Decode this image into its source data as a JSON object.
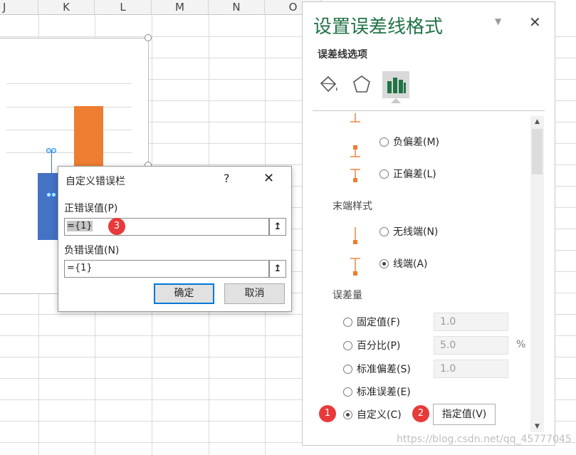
{
  "sheet": {
    "columns": [
      "J",
      "K",
      "L",
      "M",
      "N",
      "O"
    ]
  },
  "colors": {
    "bar_blue": "#4472c4",
    "bar_orange": "#ed7d31",
    "pane_title": "#217346",
    "badge_red": "#e83a3a",
    "errorbar_orange": "#ed7d31"
  },
  "dialog": {
    "title": "自定义错误栏",
    "help": "?",
    "close": "✕",
    "positive_label": "正错误值(P)",
    "positive_value": "={1}",
    "negative_label": "负错误值(N)",
    "negative_value": "={1}",
    "collapse_icon": "↥",
    "ok": "确定",
    "cancel": "取消"
  },
  "pane": {
    "title": "设置误差线格式",
    "menu_icon": "▼",
    "close": "✕",
    "subtitle": "误差线选项",
    "direction": {
      "options": [
        {
          "label": "负偏差(M)",
          "selected": false
        },
        {
          "label": "正偏差(L)",
          "selected": false
        }
      ]
    },
    "end_style": {
      "label": "末端样式",
      "options": [
        {
          "label": "无线端(N)",
          "selected": false
        },
        {
          "label": "线端(A)",
          "selected": true
        }
      ]
    },
    "amount": {
      "label": "误差量",
      "options": [
        {
          "label": "固定值(F)",
          "selected": false,
          "value": "1.0"
        },
        {
          "label": "百分比(P)",
          "selected": false,
          "value": "5.0",
          "unit": "%"
        },
        {
          "label": "标准偏差(S)",
          "selected": false,
          "value": "1.0"
        },
        {
          "label": "标准误差(E)",
          "selected": false
        },
        {
          "label": "自定义(C)",
          "selected": true
        }
      ],
      "specify_button": "指定值(V)"
    }
  },
  "badges": [
    "1",
    "2",
    "3"
  ],
  "watermark": "https://blog.csdn.net/qq_45777045"
}
